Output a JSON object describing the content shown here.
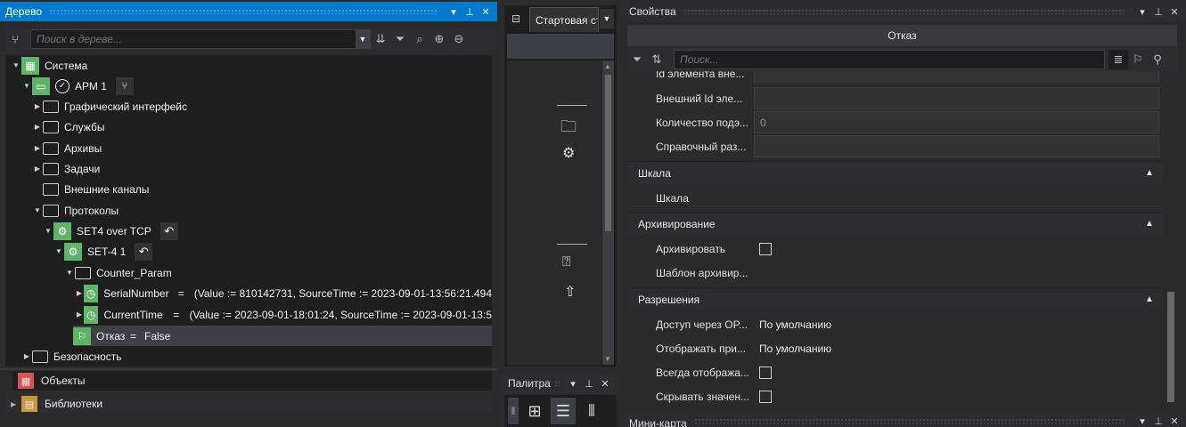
{
  "tree_panel": {
    "title": "Дерево",
    "search_placeholder": "Поиск в дереве...",
    "nodes": [
      {
        "label": "Система"
      },
      {
        "label": "АРМ 1"
      },
      {
        "label": "Графический интерфейс"
      },
      {
        "label": "Службы"
      },
      {
        "label": "Архивы"
      },
      {
        "label": "Задачи"
      },
      {
        "label": "Внешние каналы"
      },
      {
        "label": "Протоколы"
      },
      {
        "label": "SET4 over TCP"
      },
      {
        "label": "SET-4 1"
      },
      {
        "label": "Counter_Param"
      },
      {
        "label": "SerialNumber",
        "eq": "=",
        "value": "(Value := 810142731, SourceTime := 2023-09-01-13:56:21.494"
      },
      {
        "label": "CurrentTime",
        "eq": "=",
        "value": "(Value := 2023-09-01-18:01:24, SourceTime := 2023-09-01-13:5"
      },
      {
        "label": "Отказ",
        "eq": "=",
        "value": "False"
      },
      {
        "label": "Безопасность"
      }
    ]
  },
  "objects_panel": {
    "title": "Объекты"
  },
  "libraries_panel": {
    "title": "Библиотеки"
  },
  "center_panel": {
    "tab_label": "Стартовая ст"
  },
  "palette_panel": {
    "title": "Палитра"
  },
  "properties_panel": {
    "title": "Свойства",
    "object_name": "Отказ",
    "search_placeholder": "Поиск...",
    "partial_row": "Id элемента вне...",
    "rows_top": [
      {
        "label": "Внешний Id эле...",
        "value": ""
      },
      {
        "label": "Количество подэ...",
        "value": "0"
      },
      {
        "label": "Справочный раз...",
        "value": ""
      }
    ],
    "cat_scale": "Шкала",
    "scale_row": "Шкала",
    "cat_archive": "Архивирование",
    "archive_rows": [
      {
        "label": "Архивировать"
      },
      {
        "label": "Шаблон архивир..."
      }
    ],
    "cat_permissions": "Разрешения",
    "permission_rows": [
      {
        "label": "Доступ через OP...",
        "value": "По умолчанию"
      },
      {
        "label": "Отображать при...",
        "value": "По умолчанию"
      },
      {
        "label": "Всегда отобража..."
      },
      {
        "label": "Скрывать значен..."
      }
    ]
  },
  "minimap_panel": {
    "title": "Мини-карта"
  }
}
